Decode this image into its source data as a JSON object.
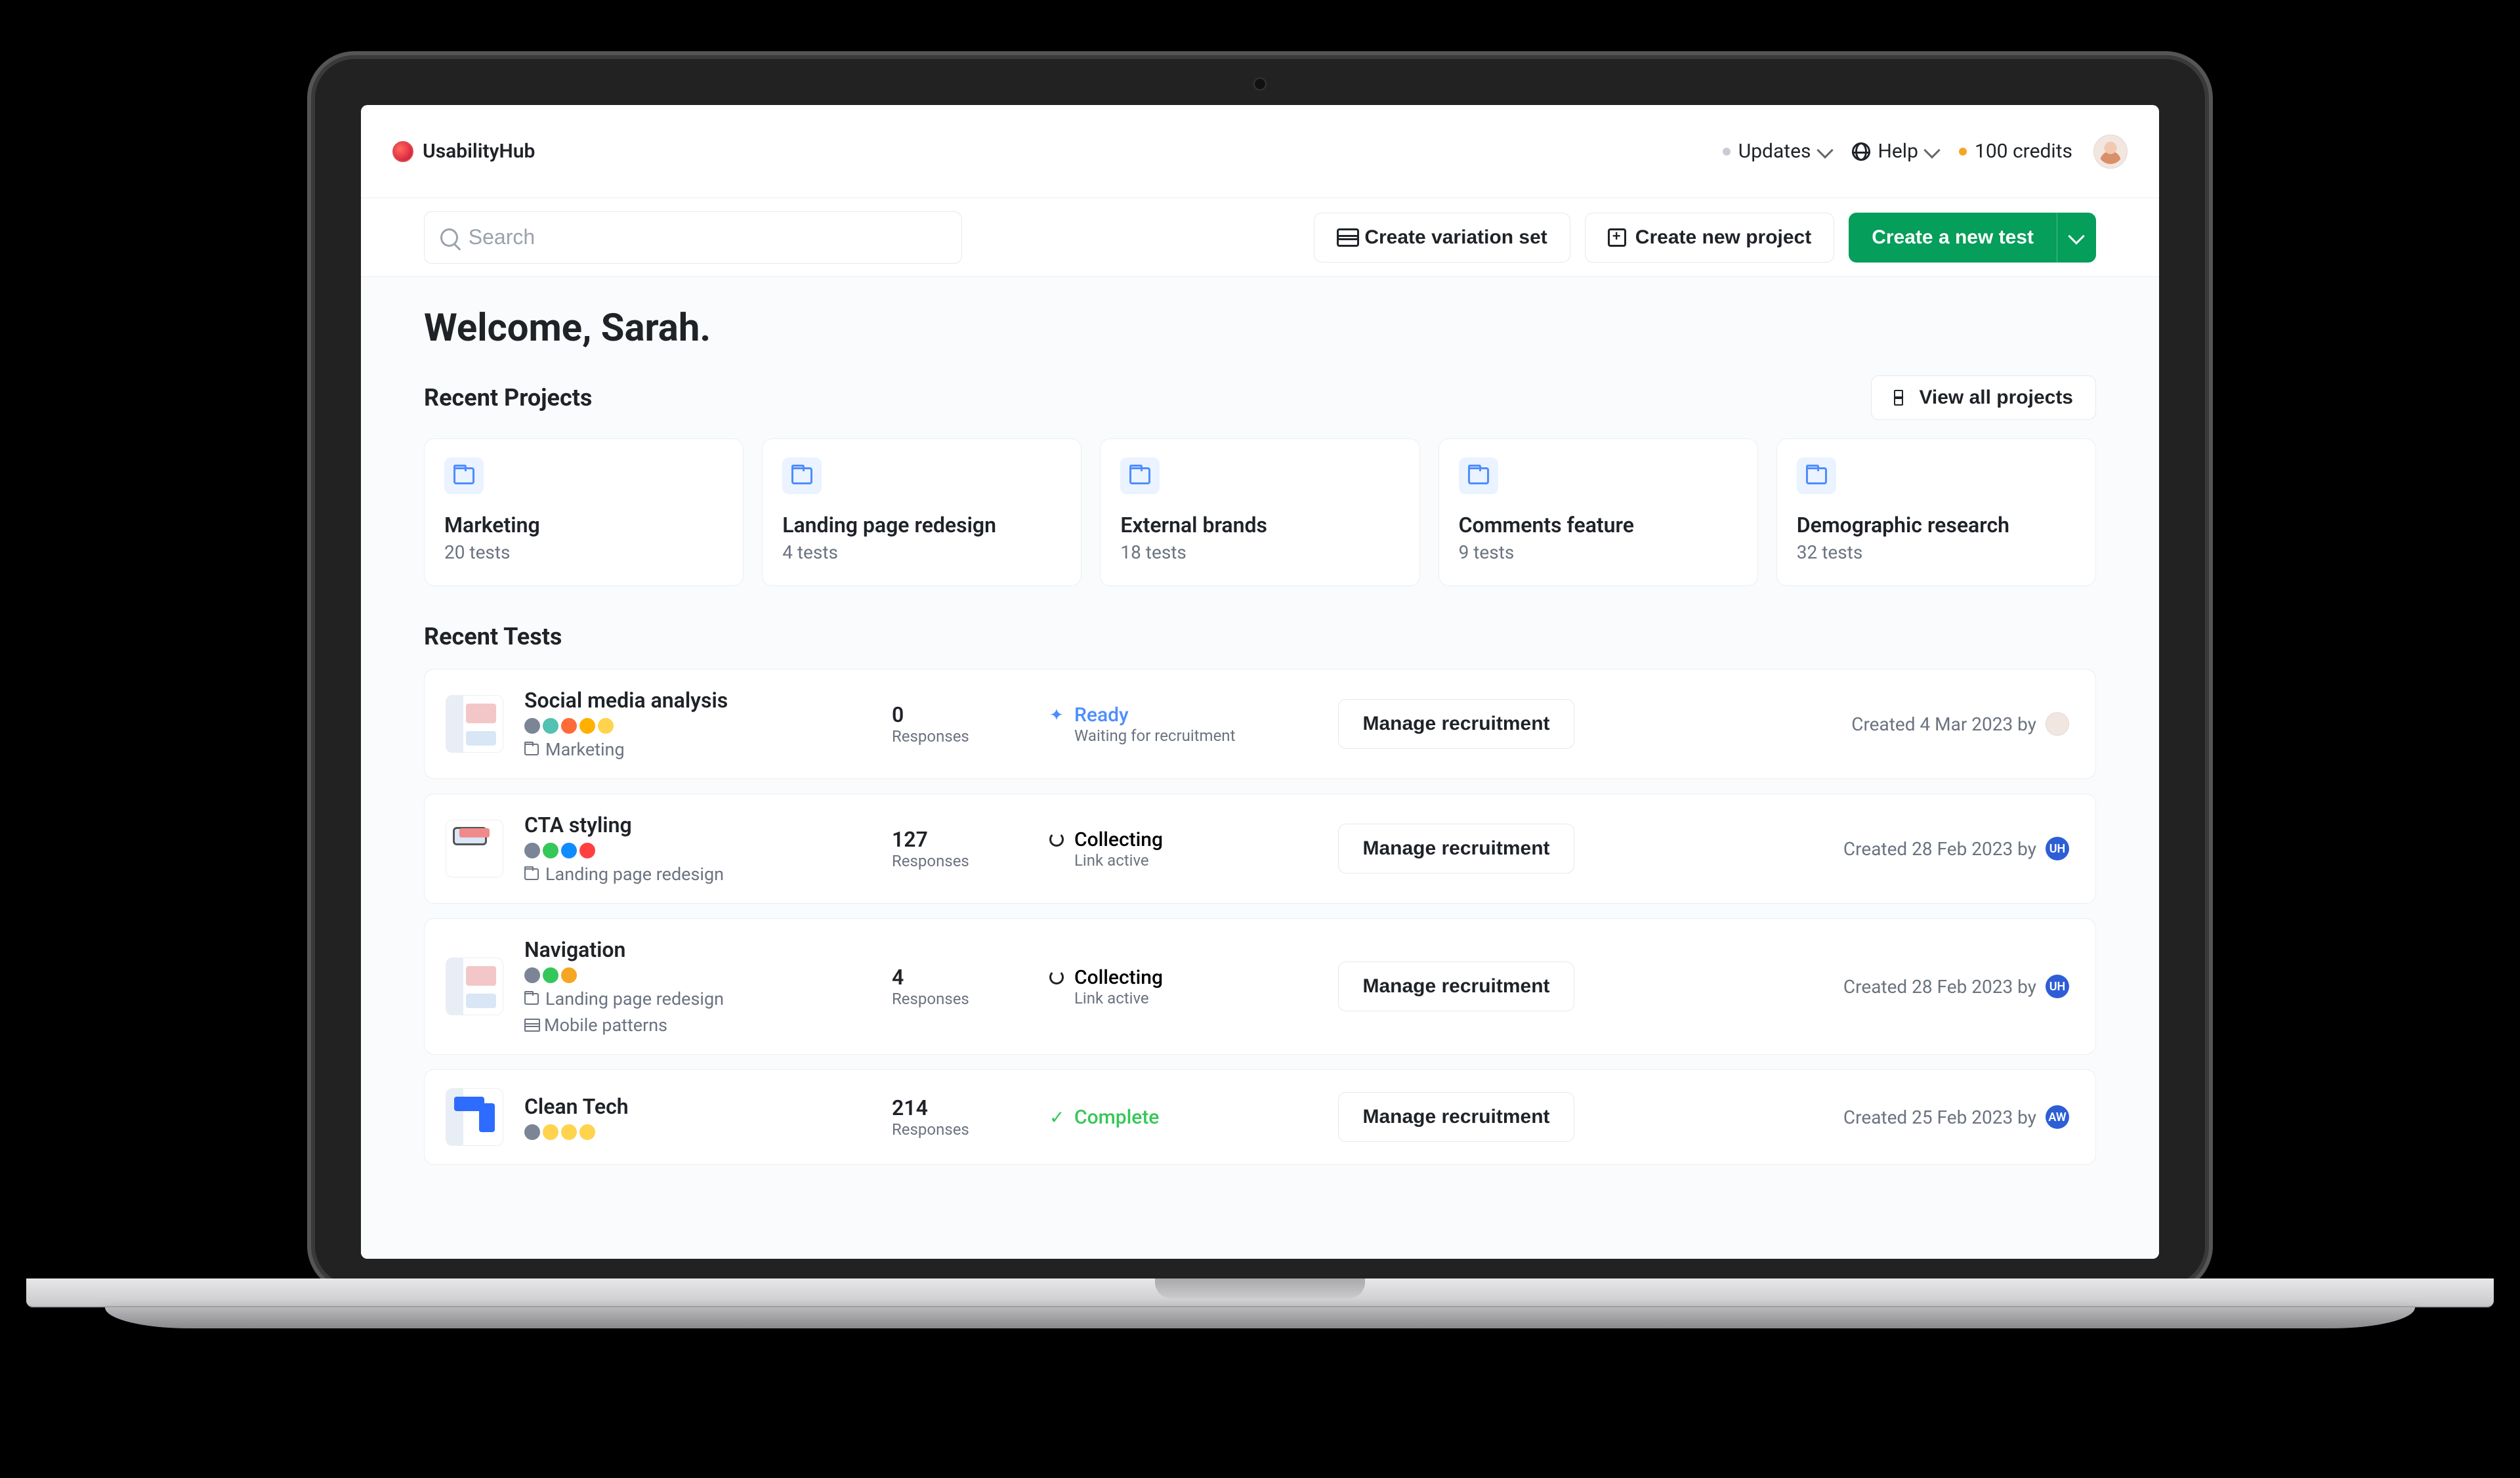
{
  "brand": "UsabilityHub",
  "topbar": {
    "updates": "Updates",
    "help": "Help",
    "credits": "100 credits"
  },
  "actions": {
    "search_placeholder": "Search",
    "variation_set": "Create variation set",
    "new_project": "Create new project",
    "new_test": "Create a new test"
  },
  "welcome": "Welcome, Sarah.",
  "recent_projects": {
    "title": "Recent Projects",
    "view_all": "View all projects",
    "items": [
      {
        "name": "Marketing",
        "sub": "20 tests"
      },
      {
        "name": "Landing page redesign",
        "sub": "4 tests"
      },
      {
        "name": "External brands",
        "sub": "18 tests"
      },
      {
        "name": "Comments feature",
        "sub": "9 tests"
      },
      {
        "name": "Demographic research",
        "sub": "32 tests"
      }
    ]
  },
  "recent_tests": {
    "title": "Recent Tests",
    "responses_label": "Responses",
    "manage_label": "Manage recruitment",
    "items": [
      {
        "name": "Social media analysis",
        "folder": "Marketing",
        "variation": null,
        "responses": "0",
        "status": {
          "name": "Ready",
          "sub": "Waiting for recruitment",
          "kind": "ready"
        },
        "created": "Created 4 Mar 2023 by",
        "avatar": {
          "type": "photo",
          "label": ""
        },
        "pills": [
          "#7b8595",
          "#52c2b2",
          "#ff6a3a",
          "#ffb000",
          "#ffd34d"
        ]
      },
      {
        "name": "CTA styling",
        "folder": "Landing page redesign",
        "variation": null,
        "responses": "127",
        "status": {
          "name": "Collecting",
          "sub": "Link active",
          "kind": "collecting"
        },
        "created": "Created 28 Feb 2023 by",
        "avatar": {
          "type": "blue",
          "label": "UH"
        },
        "pills": [
          "#7b8595",
          "#35c759",
          "#118cff",
          "#ff4040"
        ]
      },
      {
        "name": "Navigation",
        "folder": "Landing page redesign",
        "variation": "Mobile patterns",
        "responses": "4",
        "status": {
          "name": "Collecting",
          "sub": "Link active",
          "kind": "collecting"
        },
        "created": "Created 28 Feb 2023 by",
        "avatar": {
          "type": "blue",
          "label": "UH"
        },
        "pills": [
          "#7b8595",
          "#35c759",
          "#f5a623"
        ]
      },
      {
        "name": "Clean Tech",
        "folder": null,
        "variation": null,
        "responses": "214",
        "status": {
          "name": "Complete",
          "sub": "",
          "kind": "complete"
        },
        "created": "Created 25 Feb 2023 by",
        "avatar": {
          "type": "blue",
          "label": "AW"
        },
        "pills": [
          "#7b8595",
          "#ffd34d",
          "#ffd34d",
          "#ffd34d"
        ]
      }
    ]
  }
}
